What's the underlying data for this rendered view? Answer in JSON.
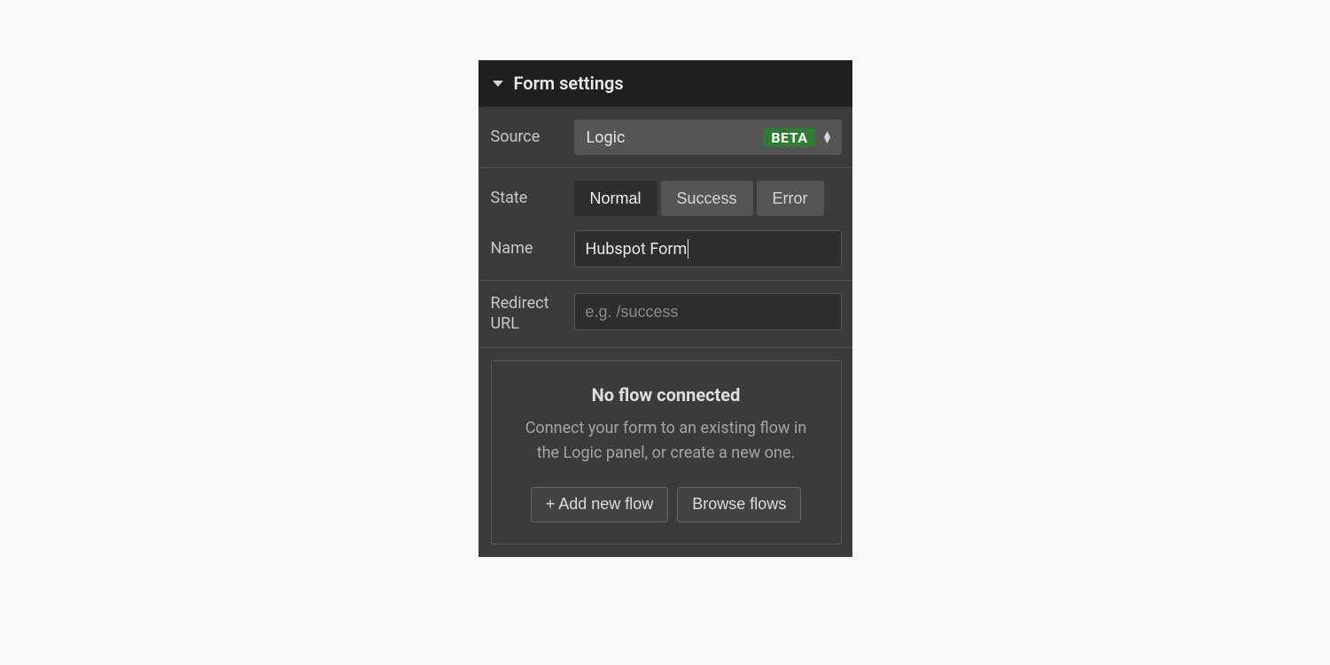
{
  "panel": {
    "title": "Form settings"
  },
  "source": {
    "label": "Source",
    "value": "Logic",
    "badge": "BETA"
  },
  "state": {
    "label": "State",
    "options": [
      "Normal",
      "Success",
      "Error"
    ],
    "active": "Normal"
  },
  "name": {
    "label": "Name",
    "value": "Hubspot Form"
  },
  "redirect": {
    "label": "Redirect URL",
    "placeholder": "e.g. /success",
    "value": ""
  },
  "flow": {
    "title": "No flow connected",
    "description": "Connect your form to an existing flow in the Logic panel, or create a new one.",
    "add_label": "+ Add new flow",
    "browse_label": "Browse flows"
  }
}
